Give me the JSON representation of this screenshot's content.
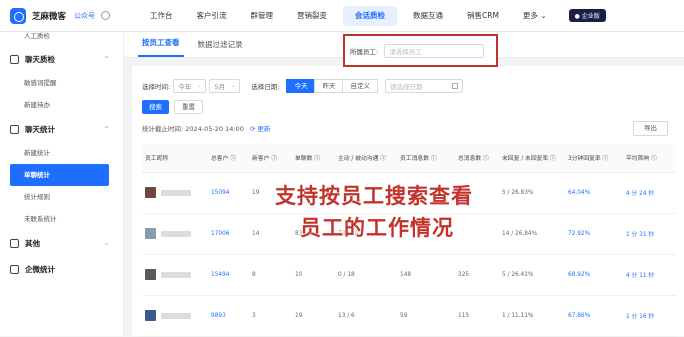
{
  "topbar": {
    "brand": "芝麻微客",
    "account": "公众号",
    "nav": [
      "工作台",
      "客户引流",
      "群管理",
      "营销裂变",
      "会话质检",
      "数据互通",
      "销售CRM",
      "更多 ⌄"
    ],
    "enterprise_badge": "● 企业版"
  },
  "sidebar": {
    "top_item": "人工质检",
    "groups": [
      {
        "label": "聊天质检",
        "items": [
          "敏感词提醒",
          "新建待办"
        ]
      },
      {
        "label": "聊天统计",
        "items": [
          "新建统计",
          "单聊统计",
          "统计规则",
          "未联系统计"
        ]
      },
      {
        "label": "其他",
        "items": []
      },
      {
        "label": "企微统计",
        "items": []
      }
    ]
  },
  "tabs": [
    "按员工查看",
    "数据过滤记录"
  ],
  "filters": {
    "time_label": "选择时间:",
    "year": "今年",
    "month": "5月",
    "date_label": "选择日期:",
    "date_options": [
      "今天",
      "昨天",
      "自定义"
    ],
    "date_placeholder": "请选择日期",
    "employee_label": "所属员工:",
    "employee_placeholder": "请选择员工",
    "search_button": "搜索",
    "reset_button": "重置"
  },
  "stat_time": "统计截止时间: 2024-05-20 14:00",
  "refresh": "更新",
  "export": "导出",
  "table": {
    "headers": [
      "员工昵称",
      "总客户 ⓘ",
      "新客户 ⓘ",
      "单聊数 ⓘ",
      "主动 / 被动沟通 ⓘ",
      "员工消息数 ⓘ",
      "总消息数 ⓘ",
      "未回复 / 未回复率 ⓘ",
      "3分钟回复率 ⓘ",
      "平均首响 ⓘ"
    ],
    "rows": [
      [
        "",
        "15094",
        "19",
        "",
        "",
        "",
        "",
        "5 / 26.83%",
        "64.04%",
        "4 分 24 秒"
      ],
      [
        "",
        "17006",
        "14",
        "83",
        "73 / 10",
        "",
        "",
        "14 / 26.84%",
        "72.92%",
        "1 分 31 秒"
      ],
      [
        "",
        "15494",
        "8",
        "10",
        "0 / 18",
        "148",
        "325",
        "5 / 26.41%",
        "68.92%",
        "4 分 11 秒"
      ],
      [
        "",
        "9893",
        "3",
        "19",
        "13 / 6",
        "59",
        "115",
        "1 / 11.11%",
        "67.86%",
        "1 分 16 秒"
      ]
    ]
  },
  "overlay": {
    "line1": "支持按员工搜索查看",
    "line2": "员工的工作情况"
  },
  "colors": {
    "accent": "#1e6fff",
    "highlight": "#c3332d"
  }
}
